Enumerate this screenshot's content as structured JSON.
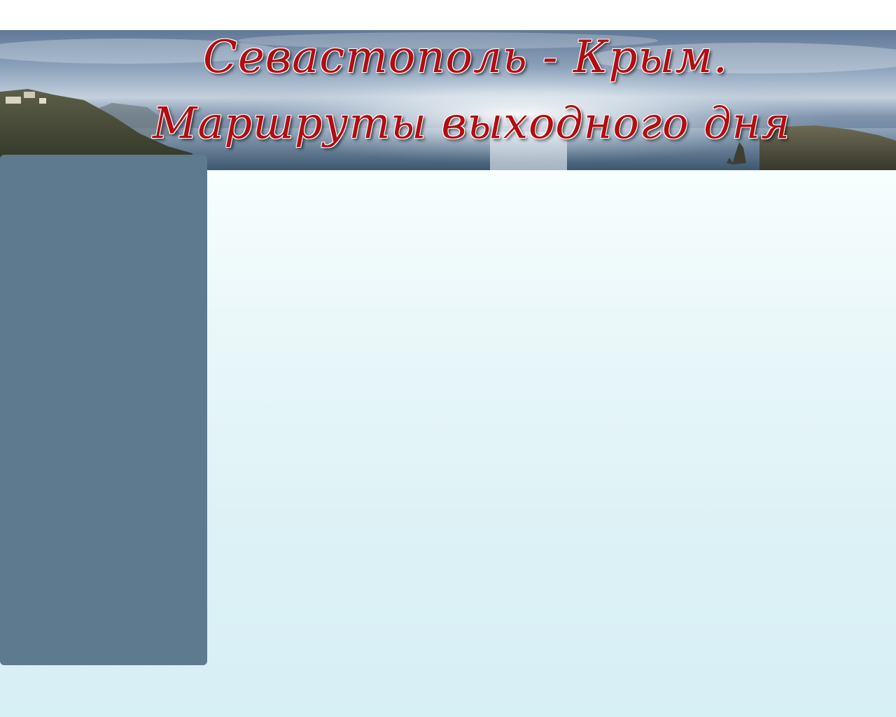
{
  "header": {
    "title_line1": "Севастополь -  Крым.",
    "title_line2": "Маршруты выходного дня"
  },
  "colors": {
    "title_red": "#b10d12",
    "sidebar": "#5e7a8f",
    "content_bg": "#dcf1f6"
  }
}
